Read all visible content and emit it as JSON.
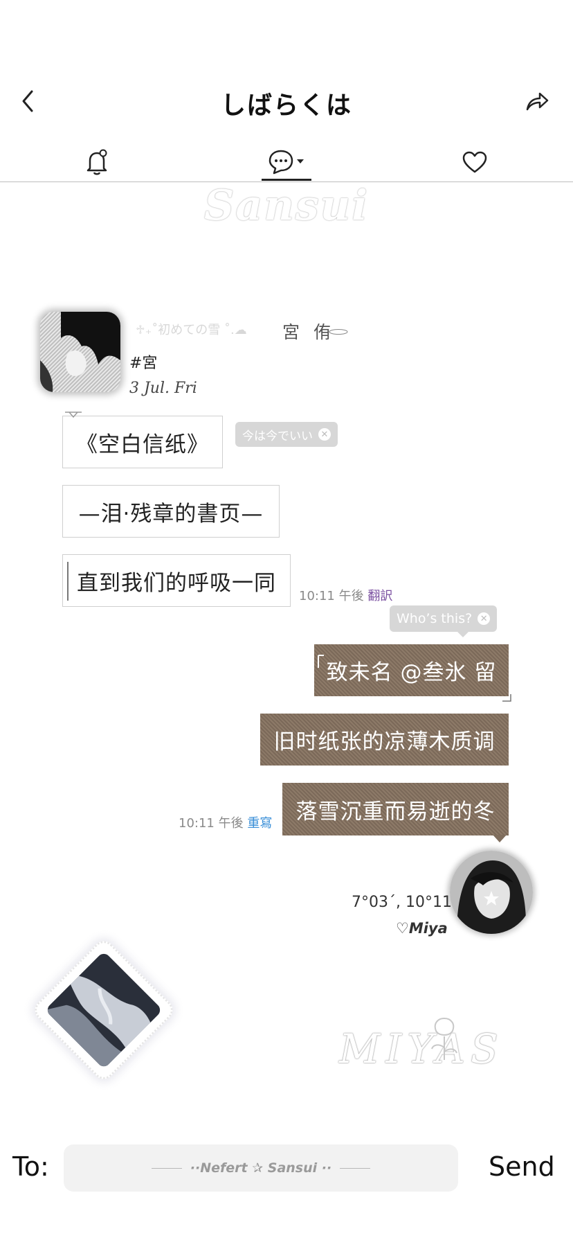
{
  "header": {
    "title": "しばらくは"
  },
  "watermark": "Sansui",
  "profile": {
    "faint_name": "♱₊˚初めての雪 ˚.☁",
    "name": "宮 侑",
    "tag": "#宮",
    "date": "3 Jul. Fri"
  },
  "messages_left": [
    {
      "text": "《空白信纸》"
    },
    {
      "text": "—泪·残章的書页—"
    },
    {
      "text": "直到我们的呼吸一同"
    }
  ],
  "left_tooltip": {
    "text": "今は今でいい"
  },
  "left_meta": {
    "time": "10:11 午後",
    "action": "翻訳"
  },
  "right_tooltip": {
    "text": "Who’s this?"
  },
  "messages_right": [
    {
      "text": "致未名 @叁氷 留"
    },
    {
      "text": "旧时纸张的凉薄木质调"
    },
    {
      "text": "落雪沉重而易逝的冬"
    }
  ],
  "right_meta": {
    "time": "10:11 午後",
    "action": "重寫"
  },
  "signature": {
    "coord": "7°03´, 10°11",
    "name": "♡Miya"
  },
  "script_logo": "MIYAS",
  "composer": {
    "to_label": "To:",
    "placeholder": "··Nefert ✰ Sansui ··",
    "send_label": "Send"
  },
  "colors": {
    "bubble_right": "#857261",
    "link_purple": "#7a4fa0",
    "link_blue": "#3a8fd8"
  },
  "icons": {
    "back": "chevron-left-icon",
    "share": "share-arrow-icon",
    "tab1": "bell-icon",
    "tab2": "chat-bubble-icon",
    "tab3": "heart-icon"
  }
}
